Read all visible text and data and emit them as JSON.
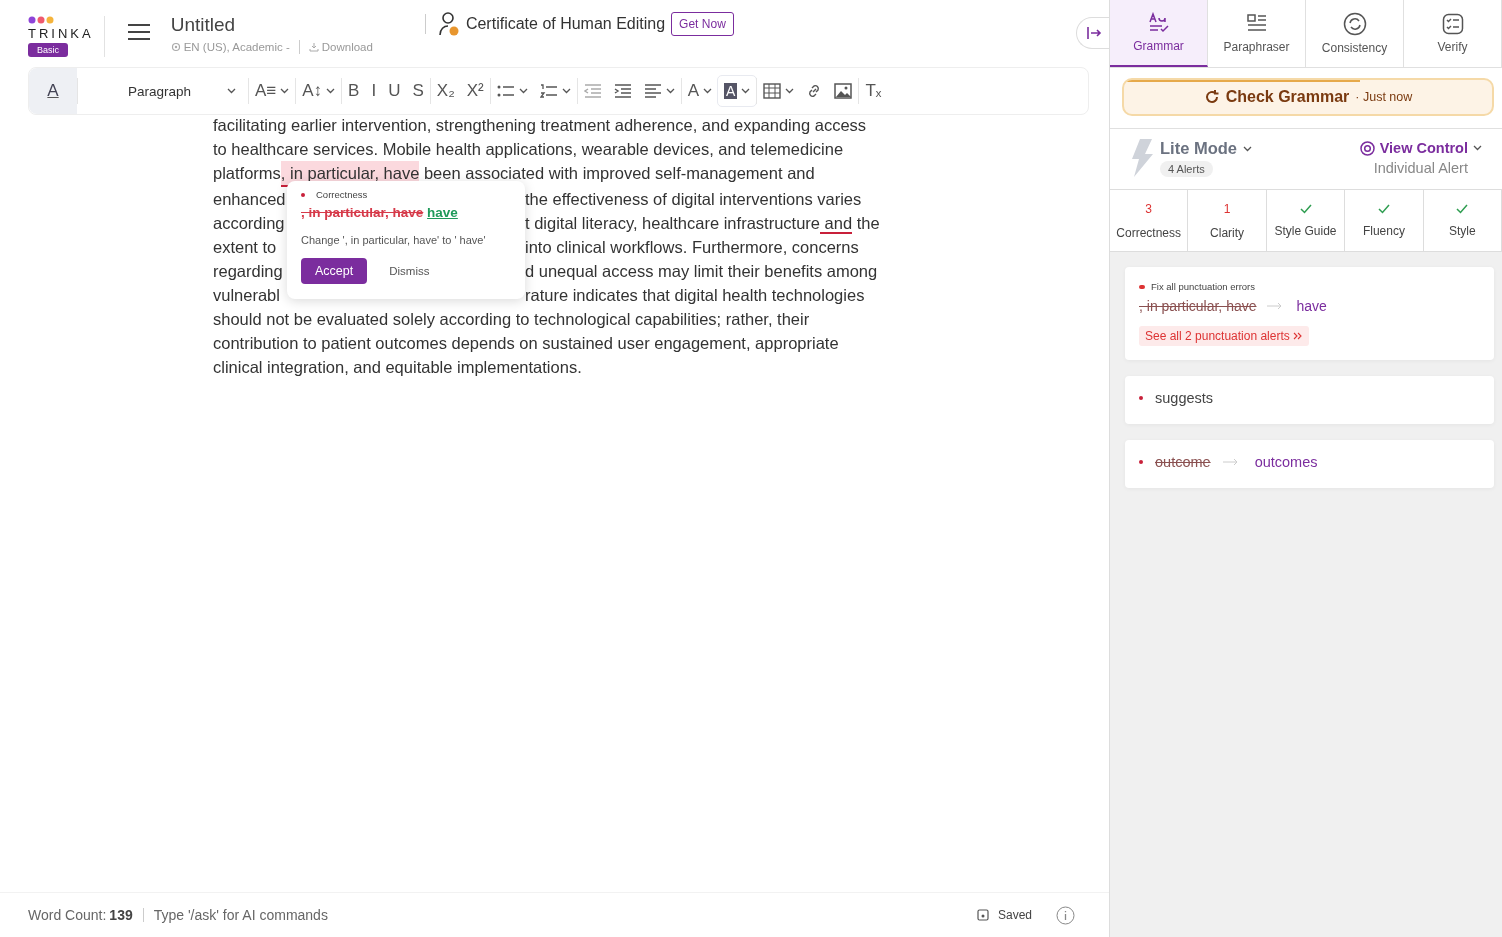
{
  "header": {
    "logo": "TRINKA",
    "plan": "Basic",
    "doc_title": "Untitled",
    "doc_meta": "EN (US), Academic -",
    "download": "Download",
    "certificate": "Certificate of Human Editing",
    "get_now": "Get Now"
  },
  "toolbar": [
    {
      "kind": "glyph",
      "glyph": "A",
      "dropdown": false,
      "active": true
    },
    {
      "kind": "select",
      "glyph": "Paragraph",
      "dropdown": true,
      "active": false
    },
    {
      "kind": "glyph",
      "glyph": "A≡",
      "dropdown": true,
      "active": false
    },
    {
      "kind": "glyph",
      "glyph": "A↕",
      "dropdown": true,
      "active": false
    },
    {
      "kind": "glyph",
      "glyph": "B",
      "dropdown": false,
      "active": false
    },
    {
      "kind": "glyph",
      "glyph": "I",
      "dropdown": false,
      "active": false
    },
    {
      "kind": "glyph",
      "glyph": "U",
      "dropdown": false,
      "active": false
    },
    {
      "kind": "glyph",
      "glyph": "S",
      "dropdown": false,
      "active": false
    },
    {
      "kind": "glyph",
      "glyph": "X₂",
      "dropdown": false,
      "active": false
    },
    {
      "kind": "glyph",
      "glyph": "X²",
      "dropdown": false,
      "active": false
    },
    {
      "kind": "bullets",
      "dropdown": true,
      "active": false
    },
    {
      "kind": "numbers",
      "dropdown": true,
      "active": false
    },
    {
      "kind": "outdent",
      "dropdown": false,
      "active": false
    },
    {
      "kind": "indent",
      "dropdown": false,
      "active": false
    },
    {
      "kind": "align",
      "dropdown": true,
      "active": false
    },
    {
      "kind": "glyph",
      "glyph": "A",
      "dropdown": true,
      "active": false
    },
    {
      "kind": "glyph",
      "glyph": "A",
      "dropdown": true,
      "active": true
    },
    {
      "kind": "table",
      "dropdown": true,
      "active": false
    },
    {
      "kind": "link",
      "dropdown": false,
      "active": false
    },
    {
      "kind": "image",
      "dropdown": false,
      "active": false
    },
    {
      "kind": "glyph",
      "glyph": "Tₓ",
      "dropdown": false,
      "active": false
    }
  ],
  "document": {
    "lines": [
      {
        "segments": [
          {
            "kind": "text",
            "text": "facilitating earlier intervention, strengthening treatment adherence, and expanding access"
          }
        ]
      },
      {
        "segments": [
          {
            "kind": "text",
            "text": "to healthcare services. Mobile health applications, wearable devices, and telemedicine"
          }
        ]
      },
      {
        "segments": [
          {
            "kind": "text",
            "text": "platforms"
          },
          {
            "kind": "flagged",
            "text": ", in particular, have"
          },
          {
            "kind": "text",
            "text": " been associated with improved self-management and"
          }
        ]
      },
      {
        "segments": [
          {
            "kind": "text",
            "text": "enhanced"
          },
          {
            "kind": "covered"
          },
          {
            "kind": "text",
            "text": "the effectiveness of digital interventions varies"
          }
        ]
      },
      {
        "segments": [
          {
            "kind": "text",
            "text": "according"
          },
          {
            "kind": "covered"
          },
          {
            "kind": "text",
            "text": "t digital literacy, healthcare infrastructure"
          },
          {
            "kind": "underlined",
            "text": " and"
          },
          {
            "kind": "text",
            "text": " the"
          }
        ]
      },
      {
        "segments": [
          {
            "kind": "text",
            "text": "extent to"
          },
          {
            "kind": "covered"
          },
          {
            "kind": "text",
            "text": "into clinical workflows. Furthermore, concerns"
          }
        ]
      },
      {
        "segments": [
          {
            "kind": "text",
            "text": "regarding"
          },
          {
            "kind": "covered"
          },
          {
            "kind": "text",
            "text": "d unequal access may limit their benefits among"
          }
        ]
      },
      {
        "segments": [
          {
            "kind": "text",
            "text": "vulnerabl"
          },
          {
            "kind": "covered"
          },
          {
            "kind": "text",
            "text": "rature indicates that digital health technologies"
          }
        ]
      },
      {
        "segments": [
          {
            "kind": "text",
            "text": "should not be evaluated solely according to technological capabilities; rather, their"
          }
        ]
      },
      {
        "segments": [
          {
            "kind": "text",
            "text": "contribution to patient outcomes depends on sustained user engagement, appropriate"
          }
        ]
      },
      {
        "segments": [
          {
            "kind": "text",
            "text": "clinical integration, and equitable implementations."
          }
        ]
      }
    ]
  },
  "popup": {
    "category": "Correctness",
    "from": ", in particular, have",
    "to": "have",
    "message": "Change ', in particular, have' to ' have'",
    "accept": "Accept",
    "dismiss": "Dismiss"
  },
  "footer": {
    "word_count_label": "Word Count:",
    "word_count": "139",
    "ai_hint": "Type '/ask' for AI commands",
    "saved": "Saved"
  },
  "panel": {
    "tabs": [
      {
        "kind": "grammar",
        "label": "Grammar",
        "selected": true
      },
      {
        "kind": "paraphraser",
        "label": "Paraphraser",
        "selected": false
      },
      {
        "kind": "consistency",
        "label": "Consistency",
        "selected": false
      },
      {
        "kind": "verify",
        "label": "Verify",
        "selected": false
      }
    ],
    "check": {
      "label": "Check Grammar",
      "time": "· Just now",
      "level": 0.64
    },
    "mode": {
      "label": "Lite Mode",
      "alerts": "4 Alerts",
      "view_control": "View Control",
      "view_value": "Individual Alert"
    },
    "categories": [
      {
        "kind": "count",
        "count": "3",
        "label": "Correctness"
      },
      {
        "kind": "count",
        "count": "1",
        "label": "Clarity"
      },
      {
        "kind": "ok",
        "label": "Style Guide"
      },
      {
        "kind": "ok",
        "label": "Fluency"
      },
      {
        "kind": "ok",
        "label": "Style"
      }
    ],
    "alerts": [
      {
        "kind": "group",
        "title": "Fix all punctuation errors",
        "from": ", in particular, have",
        "to": "have",
        "link": "See all 2 punctuation alerts"
      },
      {
        "kind": "word",
        "text": "suggests"
      },
      {
        "kind": "replace",
        "from": "outcome",
        "to": "outcomes"
      }
    ]
  }
}
